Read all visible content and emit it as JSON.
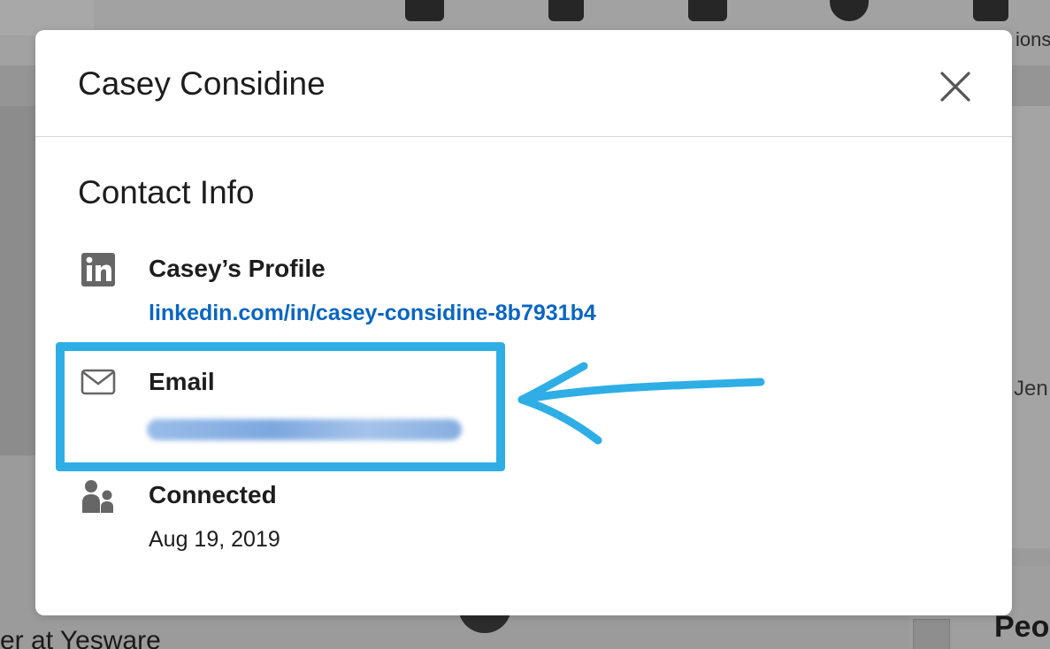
{
  "background": {
    "nav_label_fragment": "ions",
    "right_text_fragment": "Jen",
    "bottom_left_text_fragment": "er at Yesware",
    "bottom_right_text_fragment": "Peo"
  },
  "modal": {
    "title": "Casey Considine",
    "close_icon": "close-icon",
    "section_title": "Contact Info",
    "entries": [
      {
        "icon": "linkedin-icon",
        "label": "Casey’s Profile",
        "value": "linkedin.com/in/casey-considine-8b7931b4"
      },
      {
        "icon": "envelope-icon",
        "label": "Email"
      },
      {
        "icon": "connections-icon",
        "label": "Connected",
        "value": "Aug 19, 2019"
      }
    ]
  },
  "annotation": {
    "highlight_color": "#2eaee5",
    "arrow_icon": "arrow-left-icon"
  },
  "colors": {
    "link": "#0a66c2",
    "text": "#1d1d1d",
    "icon": "#666666",
    "overlay": "#9b9b9b"
  }
}
